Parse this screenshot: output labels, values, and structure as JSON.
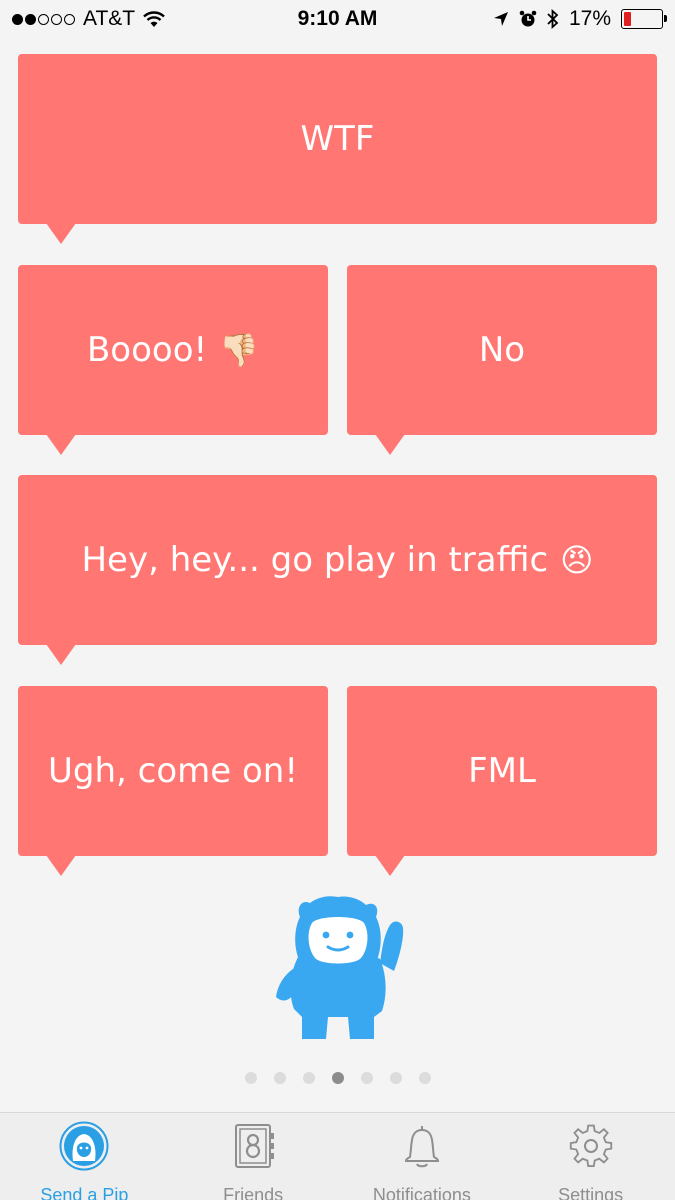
{
  "status_bar": {
    "carrier": "AT&T",
    "time": "9:10 AM",
    "battery_percent": "17%",
    "battery_level": 0.17,
    "signal_bars_filled": 2,
    "signal_bars_total": 5
  },
  "messages": [
    {
      "text": "WTF",
      "emoji": ""
    },
    {
      "text": "Boooo!",
      "emoji": "👎🏻"
    },
    {
      "text": "No",
      "emoji": ""
    },
    {
      "text": "Hey, hey... go play in traffic",
      "emoji": "😠"
    },
    {
      "text": "Ugh, come on!",
      "emoji": ""
    },
    {
      "text": "FML",
      "emoji": ""
    }
  ],
  "pagination": {
    "total": 7,
    "current": 4
  },
  "tabs": [
    {
      "label": "Send a Pip",
      "icon": "yeti-icon",
      "active": true
    },
    {
      "label": "Friends",
      "icon": "address-book-icon",
      "active": false
    },
    {
      "label": "Notifications",
      "icon": "bell-icon",
      "active": false
    },
    {
      "label": "Settings",
      "icon": "gear-icon",
      "active": false
    }
  ],
  "colors": {
    "bubble": "#ff7672",
    "accent": "#2a9fe4",
    "mascot": "#3aa7f1"
  }
}
